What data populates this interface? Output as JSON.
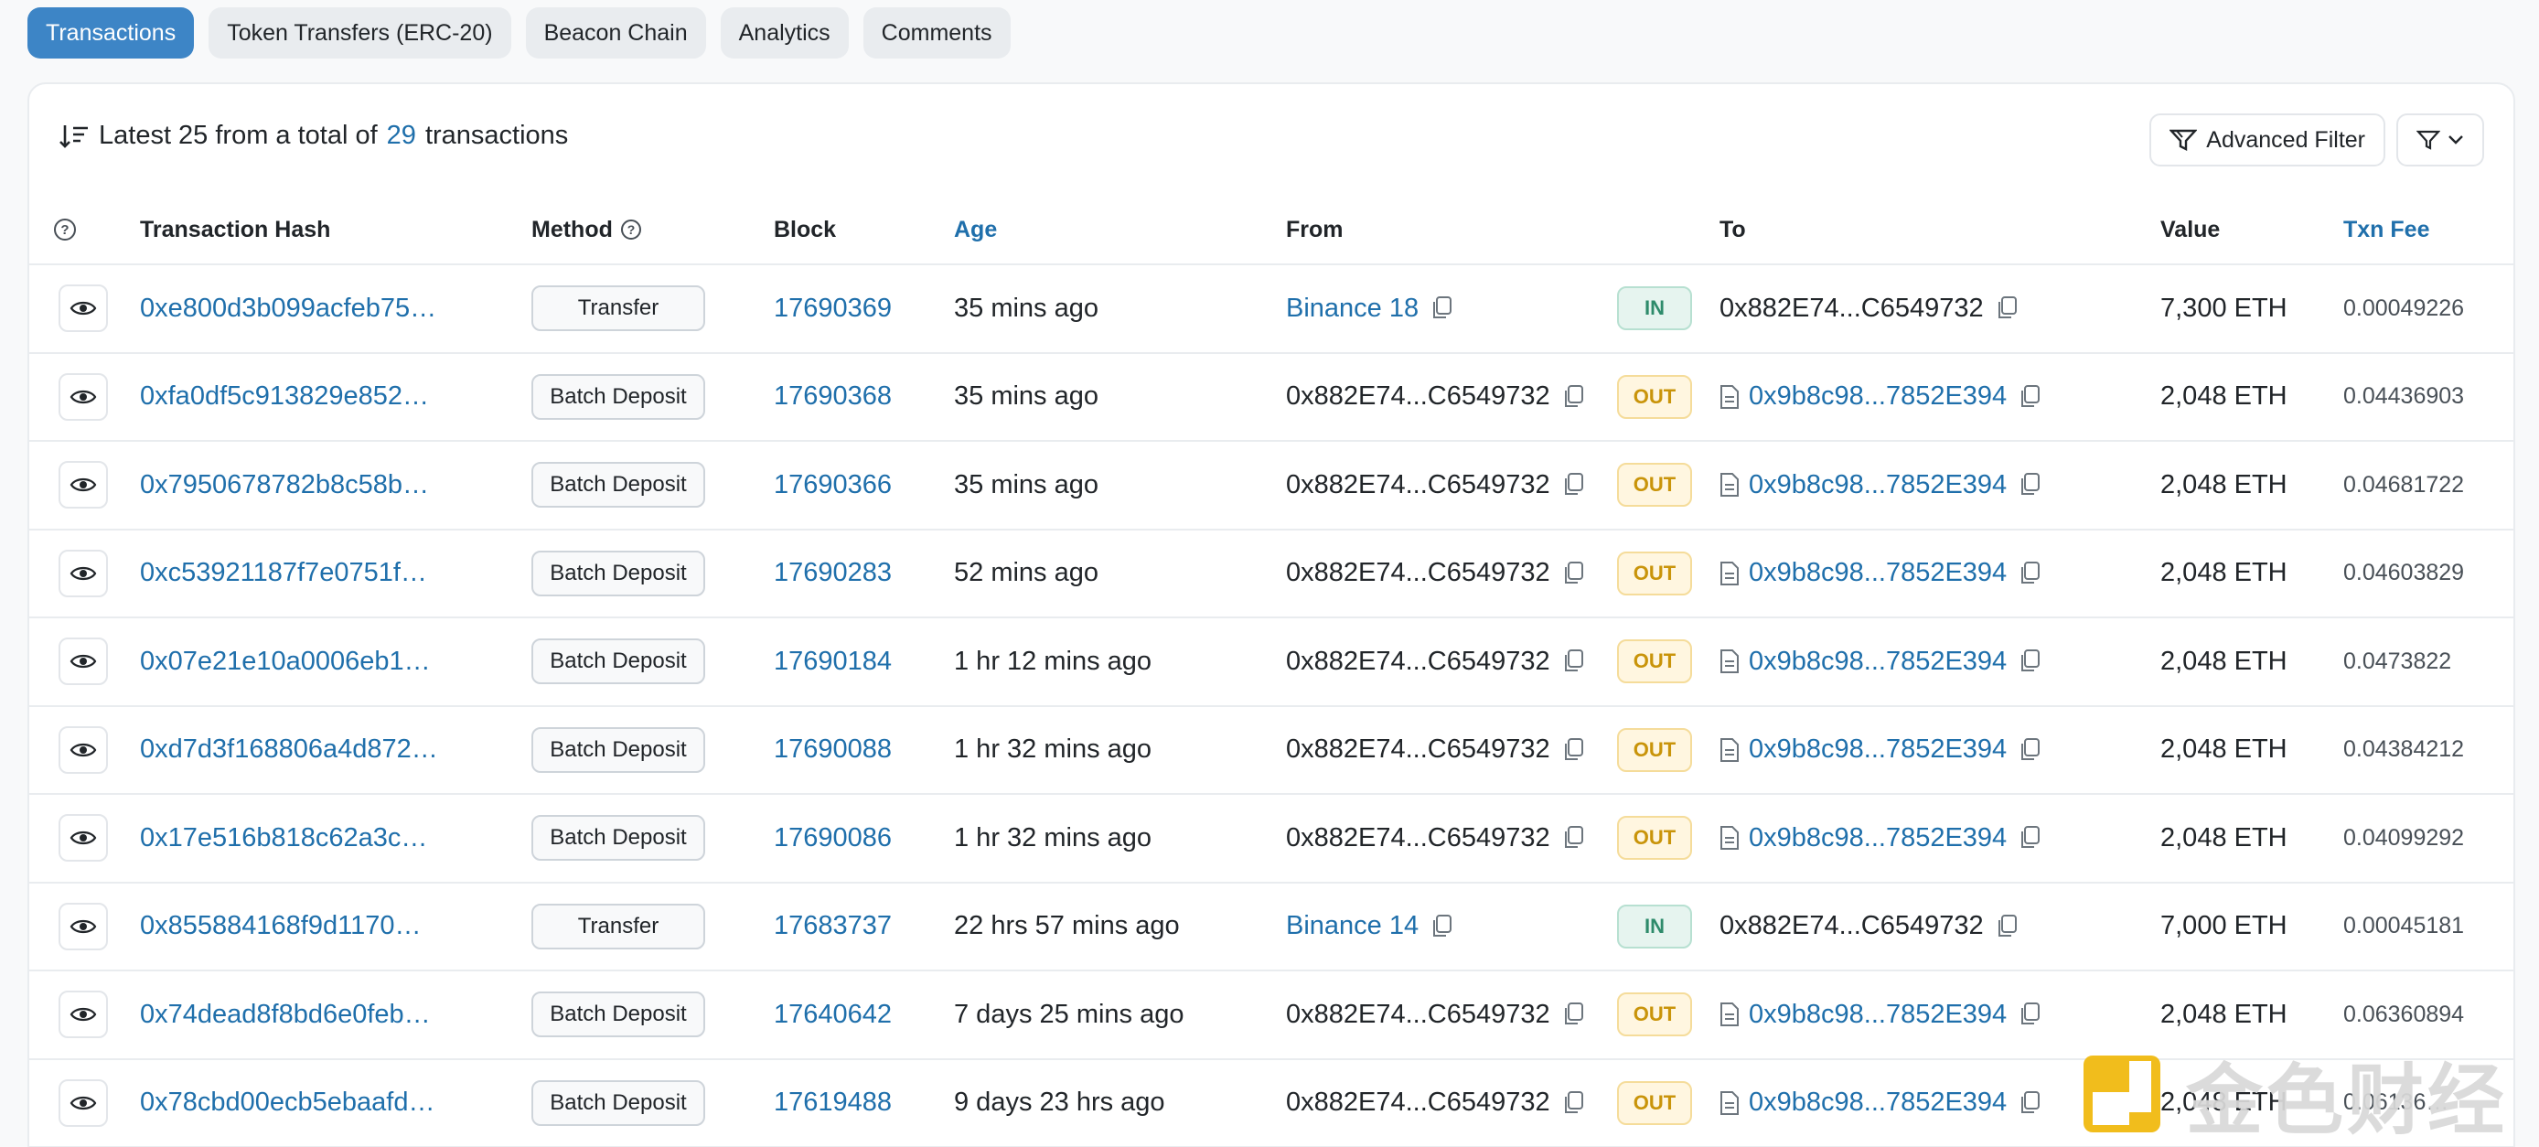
{
  "tabs": [
    {
      "label": "Transactions",
      "active": true
    },
    {
      "label": "Token Transfers (ERC-20)",
      "active": false
    },
    {
      "label": "Beacon Chain",
      "active": false
    },
    {
      "label": "Analytics",
      "active": false
    },
    {
      "label": "Comments",
      "active": false
    }
  ],
  "summary": {
    "prefix": "Latest 25 from a total of",
    "count": "29",
    "suffix": "transactions"
  },
  "advanced_filter_label": "Advanced Filter",
  "columns": {
    "hash": "Transaction Hash",
    "method": "Method",
    "block": "Block",
    "age": "Age",
    "from": "From",
    "to": "To",
    "value": "Value",
    "fee": "Txn Fee"
  },
  "rows": [
    {
      "hash": "0xe800d3b099acfeb75…",
      "method": "Transfer",
      "block": "17690369",
      "age": "35 mins ago",
      "from": "Binance 18",
      "from_link": true,
      "dir": "IN",
      "to": "0x882E74...C6549732",
      "to_contract": false,
      "value": "7,300 ETH",
      "fee": "0.00049226"
    },
    {
      "hash": "0xfa0df5c913829e852…",
      "method": "Batch Deposit",
      "block": "17690368",
      "age": "35 mins ago",
      "from": "0x882E74...C6549732",
      "from_link": false,
      "dir": "OUT",
      "to": "0x9b8c98...7852E394",
      "to_contract": true,
      "value": "2,048 ETH",
      "fee": "0.04436903"
    },
    {
      "hash": "0x7950678782b8c58b…",
      "method": "Batch Deposit",
      "block": "17690366",
      "age": "35 mins ago",
      "from": "0x882E74...C6549732",
      "from_link": false,
      "dir": "OUT",
      "to": "0x9b8c98...7852E394",
      "to_contract": true,
      "value": "2,048 ETH",
      "fee": "0.04681722"
    },
    {
      "hash": "0xc53921187f7e0751f…",
      "method": "Batch Deposit",
      "block": "17690283",
      "age": "52 mins ago",
      "from": "0x882E74...C6549732",
      "from_link": false,
      "dir": "OUT",
      "to": "0x9b8c98...7852E394",
      "to_contract": true,
      "value": "2,048 ETH",
      "fee": "0.04603829"
    },
    {
      "hash": "0x07e21e10a0006eb1…",
      "method": "Batch Deposit",
      "block": "17690184",
      "age": "1 hr 12 mins ago",
      "from": "0x882E74...C6549732",
      "from_link": false,
      "dir": "OUT",
      "to": "0x9b8c98...7852E394",
      "to_contract": true,
      "value": "2,048 ETH",
      "fee": "0.0473822"
    },
    {
      "hash": "0xd7d3f168806a4d872…",
      "method": "Batch Deposit",
      "block": "17690088",
      "age": "1 hr 32 mins ago",
      "from": "0x882E74...C6549732",
      "from_link": false,
      "dir": "OUT",
      "to": "0x9b8c98...7852E394",
      "to_contract": true,
      "value": "2,048 ETH",
      "fee": "0.04384212"
    },
    {
      "hash": "0x17e516b818c62a3c…",
      "method": "Batch Deposit",
      "block": "17690086",
      "age": "1 hr 32 mins ago",
      "from": "0x882E74...C6549732",
      "from_link": false,
      "dir": "OUT",
      "to": "0x9b8c98...7852E394",
      "to_contract": true,
      "value": "2,048 ETH",
      "fee": "0.04099292"
    },
    {
      "hash": "0x855884168f9d1170…",
      "method": "Transfer",
      "block": "17683737",
      "age": "22 hrs 57 mins ago",
      "from": "Binance 14",
      "from_link": true,
      "dir": "IN",
      "to": "0x882E74...C6549732",
      "to_contract": false,
      "value": "7,000 ETH",
      "fee": "0.00045181"
    },
    {
      "hash": "0x74dead8f8bd6e0feb…",
      "method": "Batch Deposit",
      "block": "17640642",
      "age": "7 days 25 mins ago",
      "from": "0x882E74...C6549732",
      "from_link": false,
      "dir": "OUT",
      "to": "0x9b8c98...7852E394",
      "to_contract": true,
      "value": "2,048 ETH",
      "fee": "0.06360894"
    },
    {
      "hash": "0x78cbd00ecb5ebaafd…",
      "method": "Batch Deposit",
      "block": "17619488",
      "age": "9 days 23 hrs ago",
      "from": "0x882E74...C6549732",
      "from_link": false,
      "dir": "OUT",
      "to": "0x9b8c98...7852E394",
      "to_contract": true,
      "value": "2,048 ETH",
      "fee": "0.06136…"
    }
  ],
  "watermark": {
    "text": "金色财经"
  },
  "colors": {
    "accent": "#3d85c6",
    "link": "#1f6fab",
    "in": "#2e8b6b",
    "out": "#c9940a"
  }
}
